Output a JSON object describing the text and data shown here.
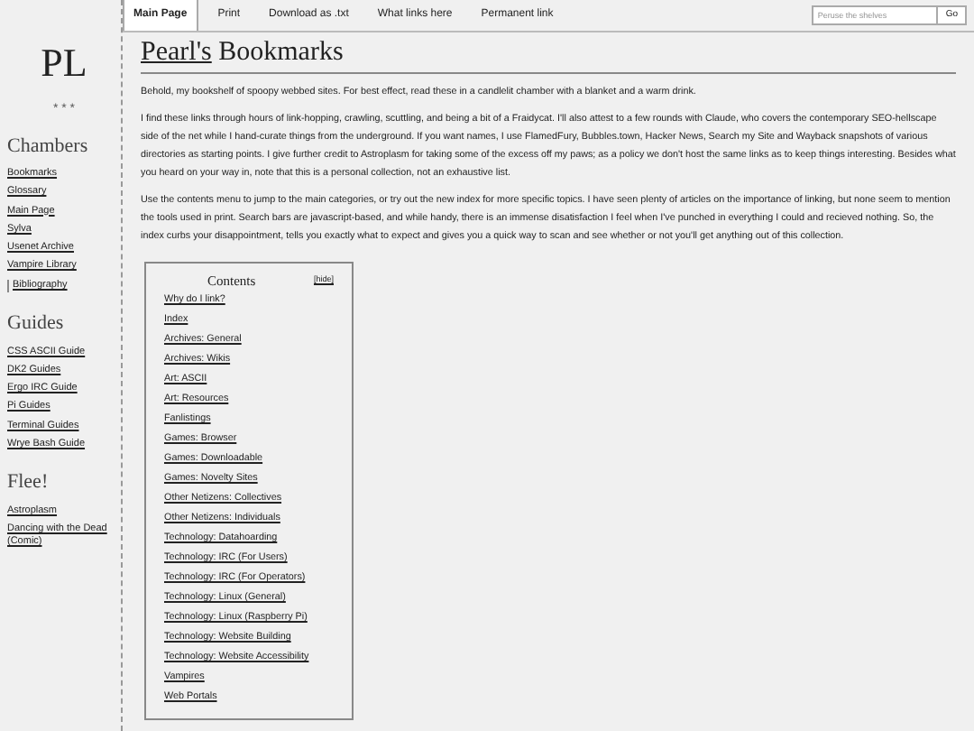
{
  "sidebar": {
    "logo": "PL",
    "ornament": "* * *",
    "sections": [
      {
        "heading": "Chambers",
        "items": [
          {
            "label": "Bookmarks",
            "selected": false
          },
          {
            "label": "Glossary",
            "selected": false
          },
          {
            "label": "Main Page",
            "selected": false
          },
          {
            "label": "Sylva",
            "selected": false
          },
          {
            "label": "Usenet Archive",
            "selected": false
          },
          {
            "label": "Vampire Library",
            "selected": false
          },
          {
            "label": "Bibliography",
            "selected": true
          }
        ]
      },
      {
        "heading": "Guides",
        "items": [
          {
            "label": "CSS ASCII Guide",
            "selected": false
          },
          {
            "label": "DK2 Guides",
            "selected": false
          },
          {
            "label": "Ergo IRC Guide",
            "selected": false
          },
          {
            "label": "Pi Guides",
            "selected": false
          },
          {
            "label": "Terminal Guides",
            "selected": false
          },
          {
            "label": "Wrye Bash Guide",
            "selected": false
          }
        ]
      },
      {
        "heading": "Flee!",
        "items": [
          {
            "label": "Astroplasm",
            "selected": false
          },
          {
            "label": "Dancing with the Dead (Comic)",
            "selected": false
          }
        ]
      }
    ]
  },
  "tabs": [
    {
      "label": "Main Page",
      "selected": true
    },
    {
      "label": "Print",
      "selected": false
    },
    {
      "label": "Download as .txt",
      "selected": false
    },
    {
      "label": "What links here",
      "selected": false
    },
    {
      "label": "Permanent link",
      "selected": false
    }
  ],
  "search": {
    "placeholder": "Peruse the shelves",
    "button": "Go"
  },
  "title": {
    "link": "Pearl's",
    "rest": "Bookmarks"
  },
  "paragraphs": [
    "Behold, my bookshelf of spoopy webbed sites. For best effect, read these in a candlelit chamber with a blanket and a warm drink.",
    "I find these links through hours of link-hopping, crawling, scuttling, and being a bit of a Fraidycat. I'll also attest to a few rounds with Claude, who covers the contemporary SEO-hellscape side of the net while I hand-curate things from the underground. If you want names, I use FlamedFury, Bubbles.town, Hacker News, Search my Site and Wayback snapshots of various directories as starting points. I give further credit to Astroplasm for taking some of the excess off my paws; as a policy we don't host the same links as to keep things interesting. Besides what you heard on your way in, note that this is a personal collection, not an exhaustive list.",
    "Use the contents menu to jump to the main categories, or try out the new index for more specific topics. I have seen plenty of articles on the importance of linking, but none seem to mention the tools used in print. Search bars are javascript-based, and while handy, there is an immense disatisfaction I feel when I've punched in everything I could and recieved nothing. So, the index curbs your disappointment, tells you exactly what to expect and gives you a quick way to scan and see whether or not you'll get anything out of this collection."
  ],
  "contents": {
    "title": "Contents",
    "toggle": "[hide]",
    "items": [
      "Why do I link?",
      "Index",
      "Archives: General",
      "Archives: Wikis",
      "Art: ASCII",
      "Art: Resources",
      "Fanlistings",
      "Games: Browser",
      "Games: Downloadable",
      "Games: Novelty Sites",
      "Other Netizens: Collectives",
      "Other Netizens: Individuals",
      "Technology: Datahoarding",
      "Technology: IRC (For Users)",
      "Technology: IRC (For Operators)",
      "Technology: Linux (General)",
      "Technology: Linux (Raspberry Pi)",
      "Technology: Website Building",
      "Technology: Website Accessibility",
      "Vampires",
      "Web Portals"
    ]
  }
}
